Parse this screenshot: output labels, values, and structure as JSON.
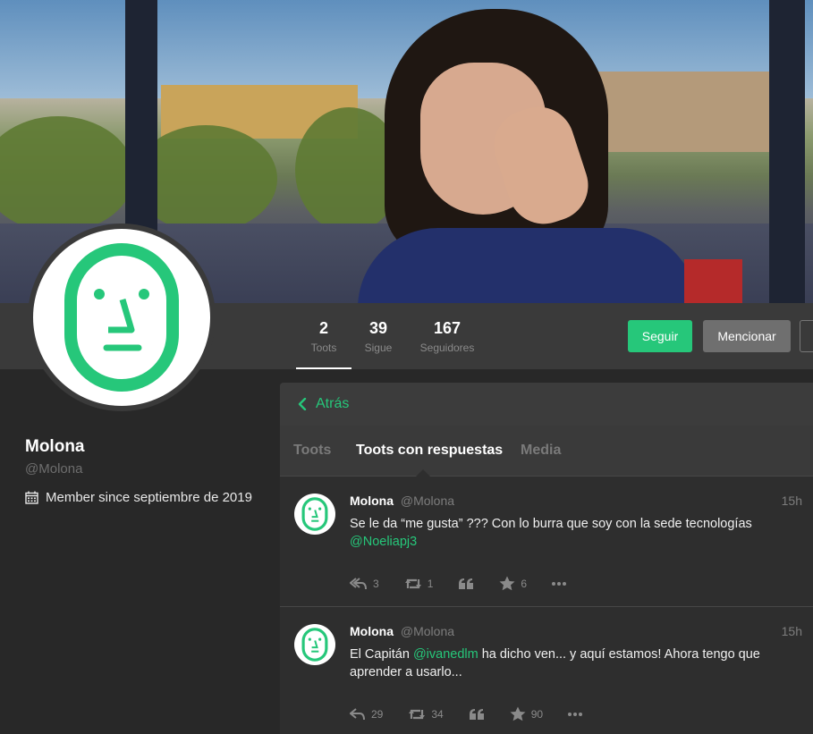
{
  "profile": {
    "name": "Molona",
    "handle": "@Molona",
    "member_since": "Member since septiembre de 2019"
  },
  "counters": [
    {
      "value": "2",
      "label": "Toots"
    },
    {
      "value": "39",
      "label": "Sigue"
    },
    {
      "value": "167",
      "label": "Seguidores"
    }
  ],
  "buttons": {
    "follow": "Seguir",
    "mention": "Mencionar"
  },
  "column": {
    "back_label": "Atrás",
    "tabs": [
      "Toots",
      "Toots con respuestas",
      "Media"
    ]
  },
  "statuses": [
    {
      "name": "Molona",
      "acct": "@Molona",
      "time": "15h",
      "text_before": "Se le da “me gusta” ??? Con lo burra que soy con la sede tecnologías ",
      "mention": "@Noeliapj3",
      "text_after": "",
      "replies": "3",
      "boosts": "1",
      "favourites": "6"
    },
    {
      "name": "Molona",
      "acct": "@Molona",
      "time": "15h",
      "text_before": "El Capitán ",
      "mention": "@ivanedlm",
      "text_after": " ha dicho ven... y aquí estamos! Ahora tengo que aprender a usarlo...",
      "replies": "29",
      "boosts": "34",
      "favourites": "90"
    }
  ],
  "colors": {
    "accent": "#26c77a",
    "background": "#282828",
    "panel": "#3a3a3a"
  }
}
